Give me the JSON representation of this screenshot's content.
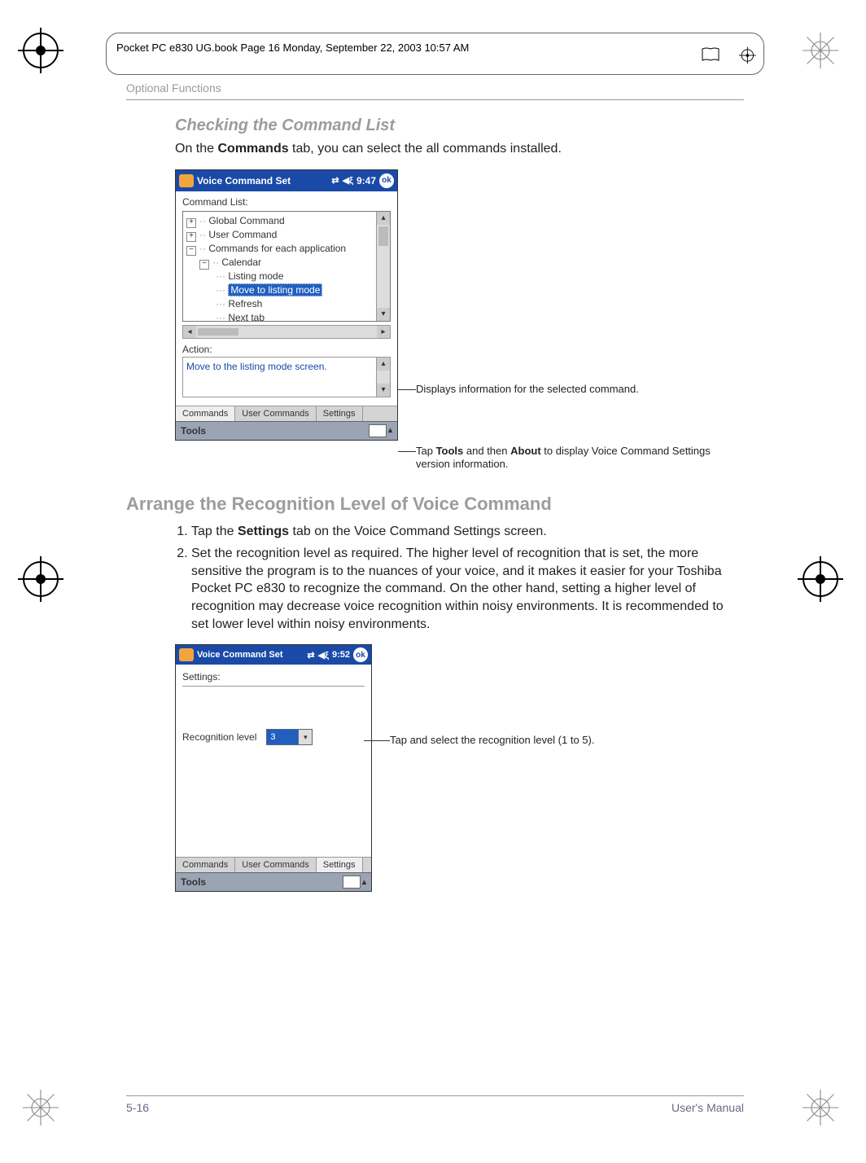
{
  "book_frame": "Pocket PC e830 UG.book  Page 16  Monday, September 22, 2003  10:57 AM",
  "running_head": "Optional Functions",
  "section1": {
    "title": "Checking the Command List",
    "body_prefix": "On the ",
    "body_bold": "Commands",
    "body_suffix": " tab, you can select the all commands installed."
  },
  "fig1": {
    "window_title": "Voice Command Set",
    "time": "9:47",
    "ok": "ok",
    "command_list_label": "Command List:",
    "tree": {
      "global": "Global Command",
      "user": "User Command",
      "each_app": "Commands for each application",
      "calendar": "Calendar",
      "listing": "Listing mode",
      "move": "Move to listing mode",
      "refresh": "Refresh",
      "next_tab": "Next tab"
    },
    "action_label": "Action:",
    "action_text": "Move to the listing mode screen.",
    "tabs": [
      "Commands",
      "User Commands",
      "Settings"
    ],
    "tools": "Tools"
  },
  "callout1": "Displays information for the selected command.",
  "callout2_pre": "Tap ",
  "callout2_b1": "Tools",
  "callout2_mid": " and then ",
  "callout2_b2": "About",
  "callout2_post": " to display Voice Command Settings version information.",
  "section2": {
    "title": "Arrange the Recognition Level of Voice Command",
    "steps": [
      {
        "pre": "Tap the ",
        "b": "Settings",
        "post": " tab on the Voice Command Settings screen."
      },
      {
        "text": "Set the recognition level as required. The higher level of recognition that is set, the more sensitive the program is to the nuances of your voice, and it makes it easier for your Toshiba Pocket PC e830 to recognize the command. On the other hand, setting a higher level of recognition may decrease voice recognition within noisy environments. It is recommended to set lower level within noisy environments."
      }
    ]
  },
  "fig2": {
    "window_title": "Voice Command Set",
    "time": "9:52",
    "ok": "ok",
    "settings_label": "Settings:",
    "rec_label": "Recognition level",
    "rec_value": "3",
    "tabs": [
      "Commands",
      "User Commands",
      "Settings"
    ],
    "tools": "Tools"
  },
  "callout3": "Tap and select the recognition level (1 to 5).",
  "footer": {
    "left": "5-16",
    "right": "User's Manual"
  }
}
